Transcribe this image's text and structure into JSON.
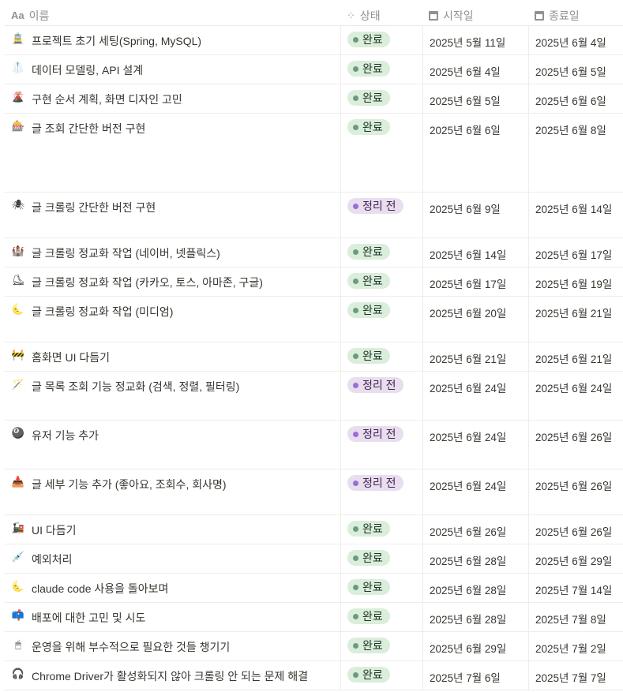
{
  "columns": {
    "name": "이름",
    "status": "상태",
    "start": "시작일",
    "end": "종료일"
  },
  "status_styles": {
    "완료": {
      "bg": "#dbeddb",
      "dot": "#6c9b7d",
      "text": "#1c3829"
    },
    "정리 전": {
      "bg": "#e8deee",
      "dot": "#9a6dd7",
      "text": "#412454"
    }
  },
  "rows": [
    {
      "icon": "🚊",
      "name": "프로젝트 초기 세팅(Spring, MySQL)",
      "status": "완료",
      "start": "2025년 5월 11일",
      "end": "2025년 6월 4일"
    },
    {
      "icon": "🥼",
      "name": "데이터 모델링, API 설계",
      "status": "완료",
      "start": "2025년 6월 4일",
      "end": "2025년 6월 5일"
    },
    {
      "icon": "🌋",
      "name": "구현 순서 계획, 화면 디자인 고민",
      "status": "완료",
      "start": "2025년 6월 5일",
      "end": "2025년 6월 6일"
    },
    {
      "icon": "🎰",
      "name": "글 조회 간단한 버전 구현",
      "status": "완료",
      "start": "2025년 6월 6일",
      "end": "2025년 6월 8일"
    },
    {
      "icon": "🕷",
      "name": "글 크롤링 간단한 버전 구현",
      "status": "정리 전",
      "start": "2025년 6월 9일",
      "end": "2025년 6월 14일"
    },
    {
      "icon": "🏰",
      "name": "글 크롤링 정교화 작업 (네이버, 넷플릭스)",
      "status": "완료",
      "start": "2025년 6월 14일",
      "end": "2025년 6월 17일"
    },
    {
      "icon": "⛸",
      "name": "글 크롤링 정교화 작업 (카카오, 토스, 아마존, 구글)",
      "status": "완료",
      "start": "2025년 6월 17일",
      "end": "2025년 6월 19일"
    },
    {
      "icon": "🌜",
      "name": "글 크롤링 정교화 작업 (미디엄)",
      "status": "완료",
      "start": "2025년 6월 20일",
      "end": "2025년 6월 21일"
    },
    {
      "icon": "🚧",
      "name": "홈화면 UI 다듬기",
      "status": "완료",
      "start": "2025년 6월 21일",
      "end": "2025년 6월 21일"
    },
    {
      "icon": "🪄",
      "name": "글 목록 조회 기능 정교화 (검색, 정렬, 필터링)",
      "status": "정리 전",
      "start": "2025년 6월 24일",
      "end": "2025년 6월 24일"
    },
    {
      "icon": "🎱",
      "name": "유저 기능 추가",
      "status": "정리 전",
      "start": "2025년 6월 24일",
      "end": "2025년 6월 26일"
    },
    {
      "icon": "📥",
      "name": "글 세부 기능 추가 (좋아요, 조회수, 회사명)",
      "status": "정리 전",
      "start": "2025년 6월 24일",
      "end": "2025년 6월 26일"
    },
    {
      "icon": "🚂",
      "name": "UI 다듬기",
      "status": "완료",
      "start": "2025년 6월 26일",
      "end": "2025년 6월 26일"
    },
    {
      "icon": "💉",
      "name": "예외처리",
      "status": "완료",
      "start": "2025년 6월 28일",
      "end": "2025년 6월 29일"
    },
    {
      "icon": "🌜",
      "name": "claude code 사용을 돌아보며",
      "status": "완료",
      "start": "2025년 6월 28일",
      "end": "2025년 7월 14일"
    },
    {
      "icon": "📫",
      "name": "배포에 대한 고민 및 시도",
      "status": "완료",
      "start": "2025년 6월 28일",
      "end": "2025년 7월 8일"
    },
    {
      "icon": "🖱",
      "name": "운영을 위해 부수적으로 필요한 것들 챙기기",
      "status": "완료",
      "start": "2025년 6월 29일",
      "end": "2025년 7월 2일"
    },
    {
      "icon": "🎧",
      "name": "Chrome Driver가 활성화되지 않아 크롤링 안 되는 문제 해결",
      "status": "완료",
      "start": "2025년 7월 6일",
      "end": "2025년 7월 7일"
    }
  ]
}
